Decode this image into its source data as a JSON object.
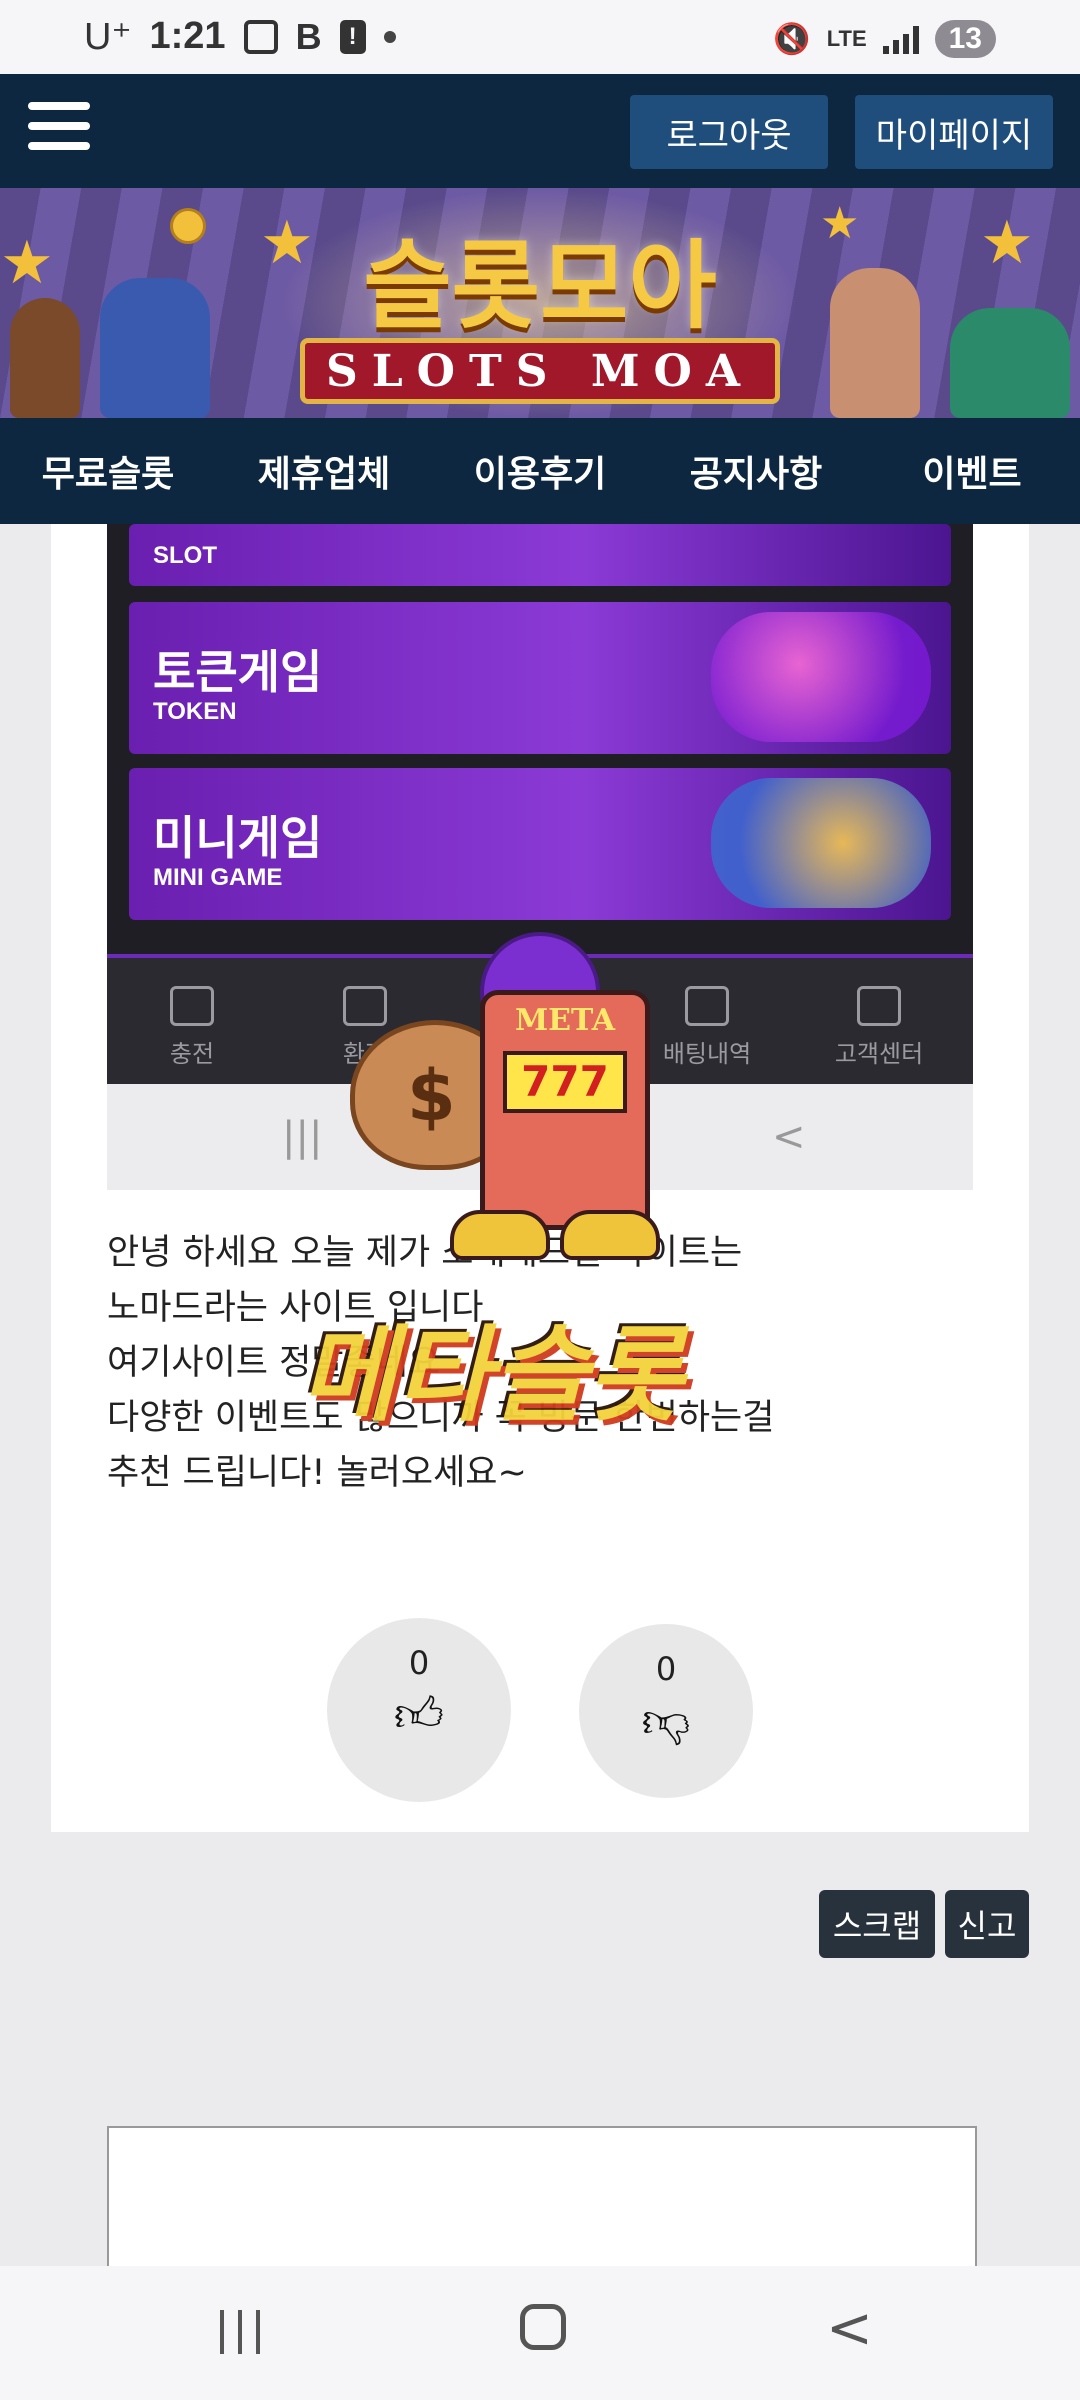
{
  "status_bar": {
    "carrier": "U⁺",
    "time": "1:21",
    "network": "LTE",
    "notification_count": "13",
    "icons": [
      "screenshot-icon",
      "b-app-icon",
      "alert-icon",
      "dot-icon",
      "mute-icon",
      "lte-icon",
      "signal-icon"
    ]
  },
  "header": {
    "logout_label": "로그아웃",
    "mypage_label": "마이페이지"
  },
  "banner": {
    "title_kr": "슬롯모아",
    "title_en": "SLOTS MOA"
  },
  "nav": {
    "items": [
      "무료슬롯",
      "제휴업체",
      "이용후기",
      "공지사항",
      "이벤트"
    ]
  },
  "embedded_screenshot": {
    "tiles": [
      {
        "title_en": "SLOT"
      },
      {
        "title_kr": "토큰게임",
        "title_en": "TOKEN"
      },
      {
        "title_kr": "미니게임",
        "title_en": "MINI GAME"
      }
    ],
    "tabbar": [
      "충전",
      "환전",
      "배팅내역",
      "고객센터"
    ],
    "nav_keys": [
      "|||",
      "○",
      "<"
    ]
  },
  "watermark": {
    "meta_label": "META",
    "reel": "777",
    "logo_text": "메타슬롯"
  },
  "post": {
    "lines": [
      "안녕 하세요 오늘 제가 소개해드릴 사이트는",
      "노마드라는 사이트 입니다",
      "여기사이트 정말좋네요",
      "다양한 이벤트도 많으니까 꼭 방문 한번하는걸",
      "추천 드립니다! 놀러오세요~"
    ]
  },
  "votes": {
    "up_count": "0",
    "down_count": "0"
  },
  "actions": {
    "scrap_label": "스크랩",
    "report_label": "신고"
  },
  "colors": {
    "header_bg": "#0e2740",
    "header_button": "#1f4e7d",
    "page_bg": "#ebebed",
    "action_button": "#28323c"
  }
}
